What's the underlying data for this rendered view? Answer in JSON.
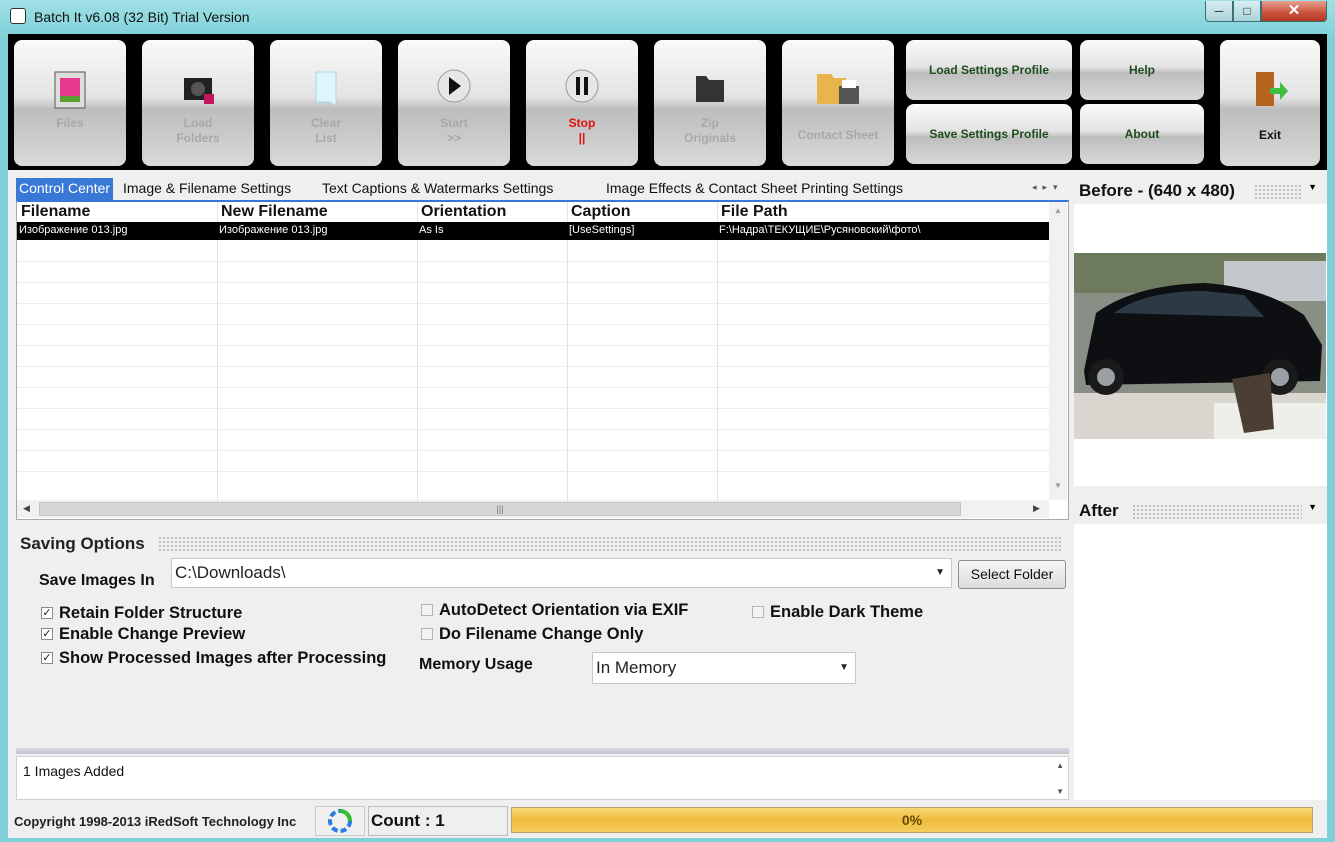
{
  "window": {
    "title": "Batch It v6.08 (32 Bit) Trial Version",
    "min": "─",
    "max": "□",
    "close": "✕"
  },
  "toolbar": {
    "files": "Files",
    "load_folders": "Load\nFolders",
    "clear_list": "Clear\nList",
    "start": "Start\n>>",
    "stop": "Stop\n||",
    "zip_originals": "Zip\nOriginals",
    "contact_sheet": "Contact Sheet",
    "load_profile": "Load Settings Profile",
    "save_profile": "Save Settings Profile",
    "help": "Help",
    "about": "About",
    "exit": "Exit"
  },
  "tabs": [
    "Control Center",
    "Image & Filename Settings",
    "Text Captions & Watermarks Settings",
    "Image Effects & Contact Sheet Printing Settings"
  ],
  "grid": {
    "columns": [
      "Filename",
      "New Filename",
      "Orientation",
      "Caption",
      "File Path"
    ],
    "rows": [
      [
        "Изображение 013.jpg",
        "Изображение 013.jpg",
        "As Is",
        "[UseSettings]",
        "F:\\Надра\\ТЕКУЩИЕ\\Русяновский\\фото\\"
      ]
    ]
  },
  "saving": {
    "header": "Saving Options",
    "save_in_label": "Save Images In",
    "save_in_value": "C:\\Downloads\\",
    "select_folder": "Select Folder",
    "options": [
      {
        "label": "Retain Folder Structure",
        "checked": true
      },
      {
        "label": "Enable Change Preview",
        "checked": true
      },
      {
        "label": "Show Processed Images after Processing",
        "checked": true
      },
      {
        "label": "AutoDetect Orientation via EXIF",
        "checked": false
      },
      {
        "label": "Do Filename Change Only",
        "checked": false
      },
      {
        "label": "Enable Dark Theme",
        "checked": false
      }
    ],
    "memory_label": "Memory Usage",
    "memory_value": "In Memory"
  },
  "log": {
    "text": "1 Images Added"
  },
  "preview": {
    "before": "Before - (640 x 480)",
    "after": "After"
  },
  "status": {
    "copyright": "Copyright 1998-2013 iRedSoft Technology Inc",
    "count": "Count : 1",
    "progress_label": "0%",
    "progress": 0
  }
}
